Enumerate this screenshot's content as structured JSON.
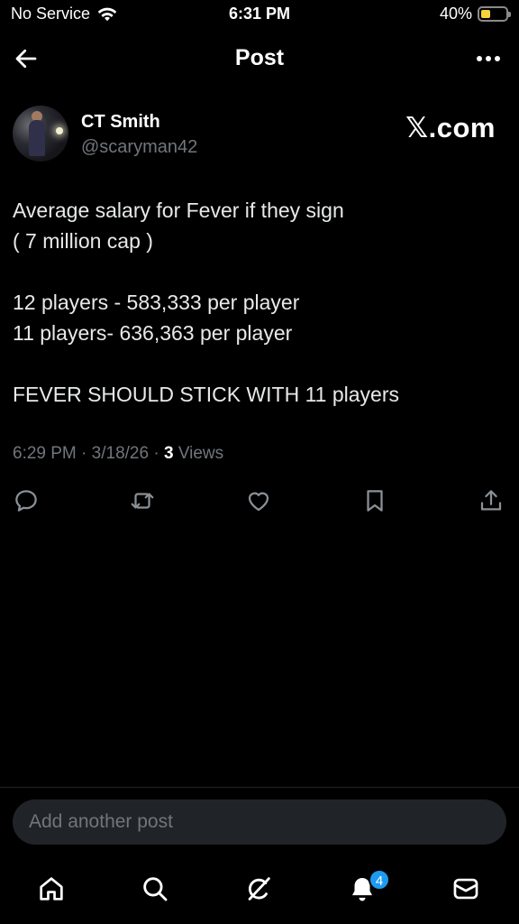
{
  "status_bar": {
    "carrier": "No Service",
    "time": "6:31 PM",
    "battery_percent_label": "40%",
    "battery_level": 0.4,
    "battery_color": "#f5d33b"
  },
  "header": {
    "title": "Post",
    "back_icon": "arrow-left-icon",
    "more_icon": "more-horizontal-icon"
  },
  "author": {
    "name": "CT Smith",
    "handle": "@scaryman42",
    "logo_text": "𝕏.com"
  },
  "post": {
    "lines": [
      "Average salary for Fever if they sign",
      "( 7 million cap )",
      "",
      "12 players - 583,333 per player",
      "11 players- 636,363 per player",
      "",
      "FEVER SHOULD STICK WITH 11 players"
    ],
    "time": "6:29 PM",
    "date": "3/18/26",
    "views_count": "3",
    "views_label": "Views",
    "separator": "·"
  },
  "actions": [
    {
      "name": "reply-icon"
    },
    {
      "name": "repost-icon"
    },
    {
      "name": "like-icon"
    },
    {
      "name": "bookmark-icon"
    },
    {
      "name": "share-icon"
    }
  ],
  "reply": {
    "placeholder": "Add another post"
  },
  "tabbar": {
    "items": [
      "home-icon",
      "search-icon",
      "grok-icon",
      "notifications-icon",
      "messages-icon"
    ],
    "notifications_badge": "4",
    "accent": "#1d9bf0"
  }
}
